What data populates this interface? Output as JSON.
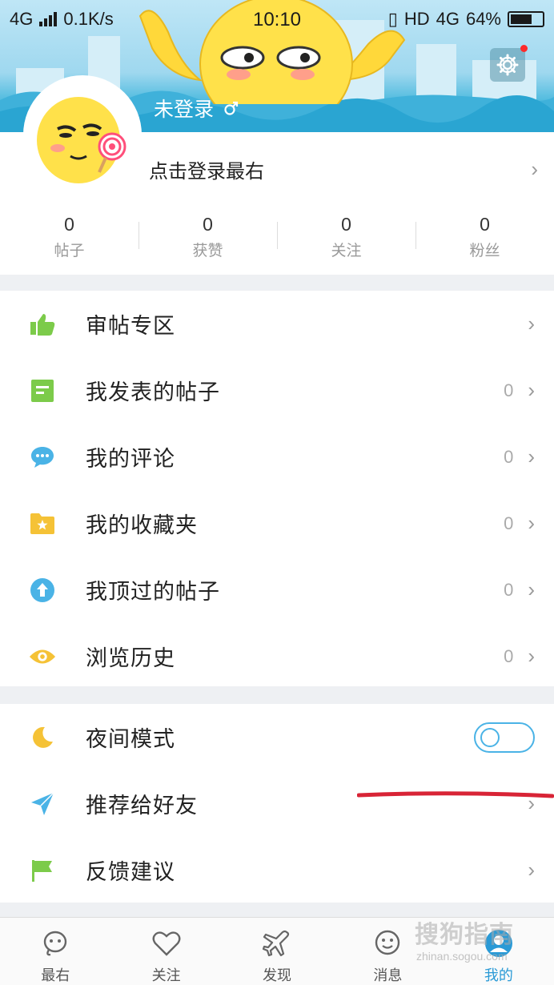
{
  "status_bar": {
    "network": "4G",
    "speed": "0.1K/s",
    "time": "10:10",
    "hd": "HD",
    "net2": "4G",
    "battery": "64%"
  },
  "profile": {
    "username": "未登录",
    "login_prompt": "点击登录最右",
    "stats": [
      {
        "value": "0",
        "label": "帖子"
      },
      {
        "value": "0",
        "label": "获赞"
      },
      {
        "value": "0",
        "label": "关注"
      },
      {
        "value": "0",
        "label": "粉丝"
      }
    ]
  },
  "menu_group1": [
    {
      "label": "审帖专区",
      "count": "",
      "icon": "thumbs-up-icon",
      "color": "#7ccb4a"
    },
    {
      "label": "我发表的帖子",
      "count": "0",
      "icon": "document-icon",
      "color": "#7ccb4a"
    },
    {
      "label": "我的评论",
      "count": "0",
      "icon": "comment-icon",
      "color": "#4ab3e6"
    },
    {
      "label": "我的收藏夹",
      "count": "0",
      "icon": "folder-star-icon",
      "color": "#f5c236"
    },
    {
      "label": "我顶过的帖子",
      "count": "0",
      "icon": "up-arrow-icon",
      "color": "#4ab3e6"
    },
    {
      "label": "浏览历史",
      "count": "0",
      "icon": "eye-icon",
      "color": "#f5c236"
    }
  ],
  "menu_group2": [
    {
      "label": "夜间模式",
      "icon": "moon-icon",
      "color": "#f5c236",
      "toggle_on": false
    },
    {
      "label": "推荐给好友",
      "icon": "paper-plane-icon",
      "color": "#4ab3e6"
    },
    {
      "label": "反馈建议",
      "icon": "flag-icon",
      "color": "#7ccb4a"
    }
  ],
  "bottom_nav": [
    {
      "label": "最右",
      "icon": "home-face-icon",
      "active": false
    },
    {
      "label": "关注",
      "icon": "heart-icon",
      "active": false
    },
    {
      "label": "发现",
      "icon": "airplane-icon",
      "active": false
    },
    {
      "label": "消息",
      "icon": "chat-face-icon",
      "active": false
    },
    {
      "label": "我的",
      "icon": "profile-icon",
      "active": true
    }
  ],
  "watermark": {
    "text": "搜狗指南",
    "sub": "zhinan.sogou.com"
  },
  "colors": {
    "accent": "#2a9ad6",
    "banner_top": "#bfe6f6",
    "banner_bottom": "#2aa7d3",
    "annotation_red": "#d82436"
  }
}
